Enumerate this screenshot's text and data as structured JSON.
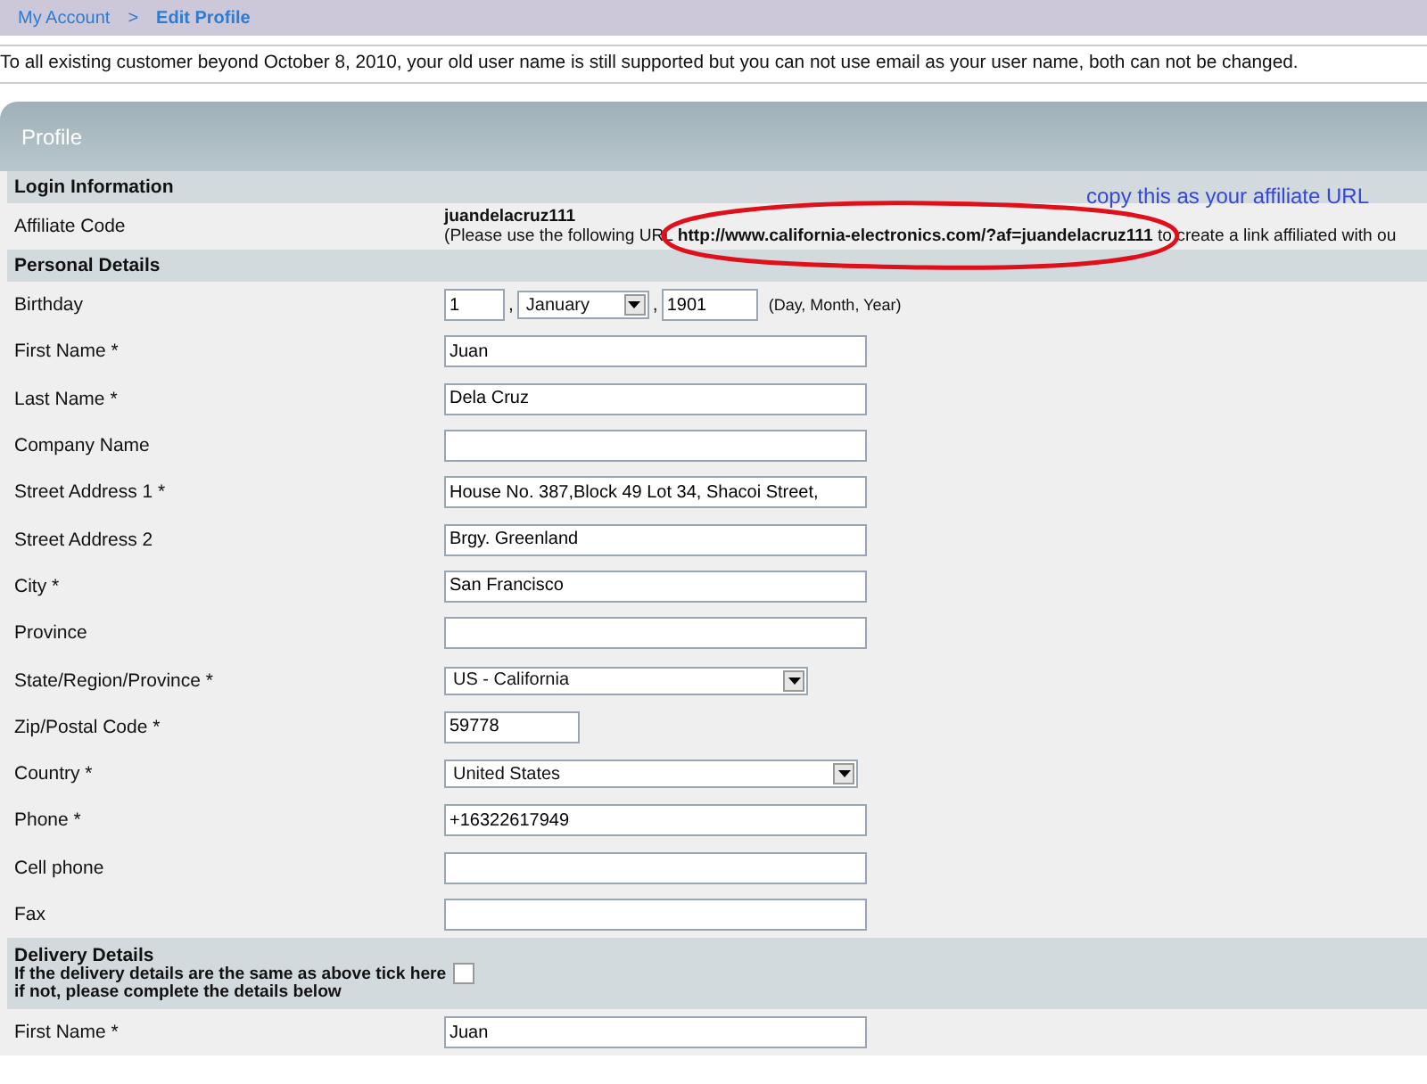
{
  "breadcrumb": [
    {
      "label": "My Account",
      "current": false
    },
    {
      "label": "Edit Profile",
      "current": true
    }
  ],
  "breadcrumb_separator": ">",
  "notice": "To all existing customer beyond October 8, 2010, your old user name is still supported but you can not use email as your user name, both can not be changed.",
  "panel_title": "Profile",
  "annotation": {
    "note": "copy this as your affiliate URL"
  },
  "login_section": {
    "title": "Login Information",
    "affiliate_label": "Affiliate Code",
    "affiliate_code": "juandelacruz111",
    "instructions": "(Please use the following URL **http://www.california-electronics.com/?af=juandelacruz111** to create a link affiliated with ou"
  },
  "personal_section": {
    "title": "Personal Details",
    "fields": [
      {
        "kind": "date",
        "label": "Birthday",
        "day": "1",
        "separator": ",",
        "month": "January",
        "year": "1901",
        "hint": "(Day, Month, Year)"
      },
      {
        "kind": "text",
        "label": "First Name *",
        "value": "Juan"
      },
      {
        "kind": "text",
        "label": "Last Name *",
        "value": "Dela Cruz"
      },
      {
        "kind": "text",
        "label": "Company Name"
      },
      {
        "kind": "text",
        "label": "Street Address 1 *",
        "value": "House No. 387,Block 49 Lot 34, Shacoi Street,"
      },
      {
        "kind": "text",
        "label": "Street Address 2",
        "value": "Brgy. Greenland"
      },
      {
        "kind": "text",
        "label": "City *",
        "value": "San Francisco"
      },
      {
        "kind": "text",
        "label": "Province"
      },
      {
        "kind": "select",
        "label": "State/Region/Province *",
        "value": "US - California"
      },
      {
        "kind": "short",
        "label": "Zip/Postal Code *",
        "value": "59778"
      },
      {
        "kind": "select-wide",
        "label": "Country *",
        "value": "United States"
      },
      {
        "kind": "text",
        "label": "Phone *",
        "value": "+16322617949"
      },
      {
        "kind": "text",
        "label": "Cell phone"
      },
      {
        "kind": "text",
        "label": "Fax"
      }
    ]
  },
  "delivery_section": {
    "title": "Delivery Details",
    "same_as_above_label": "If the delivery details are the same as above tick here\nif not, please complete the details below",
    "same_as_above_checked": false,
    "fields": [
      {
        "kind": "text",
        "label": "First Name *",
        "value": "Juan"
      }
    ]
  }
}
